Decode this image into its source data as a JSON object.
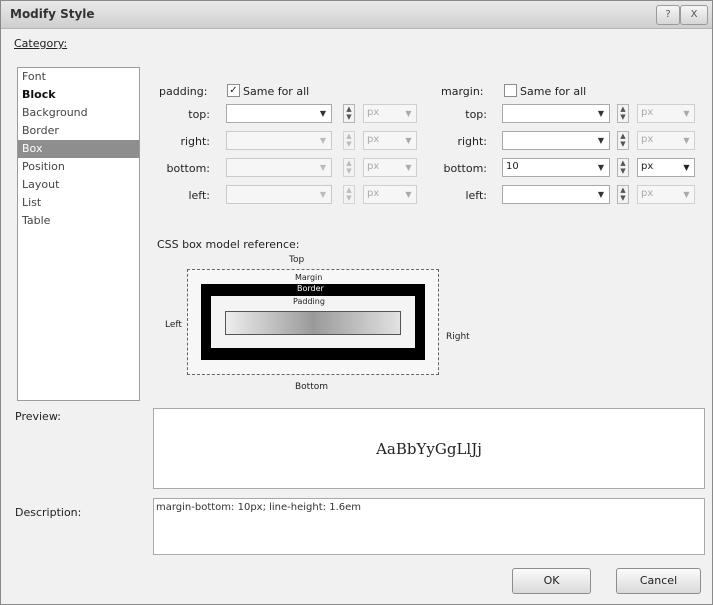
{
  "window": {
    "title": "Modify Style",
    "controls": [
      "?",
      "X"
    ]
  },
  "category": {
    "label": "Category:",
    "items": [
      {
        "label": "Font",
        "state": "normal"
      },
      {
        "label": "Block",
        "state": "bold"
      },
      {
        "label": "Background",
        "state": "normal"
      },
      {
        "label": "Border",
        "state": "normal"
      },
      {
        "label": "Box",
        "state": "selected"
      },
      {
        "label": "Position",
        "state": "normal"
      },
      {
        "label": "Layout",
        "state": "normal"
      },
      {
        "label": "List",
        "state": "normal"
      },
      {
        "label": "Table",
        "state": "normal"
      }
    ]
  },
  "padding": {
    "label": "padding:",
    "same_for_all_label": "Same for all",
    "same_for_all_checked": true,
    "sides": [
      {
        "label": "top:",
        "value": "",
        "unit": "px",
        "enabled": true
      },
      {
        "label": "right:",
        "value": "",
        "unit": "px",
        "enabled": false
      },
      {
        "label": "bottom:",
        "value": "",
        "unit": "px",
        "enabled": false
      },
      {
        "label": "left:",
        "value": "",
        "unit": "px",
        "enabled": false
      }
    ]
  },
  "margin": {
    "label": "margin:",
    "same_for_all_label": "Same for all",
    "same_for_all_checked": false,
    "sides": [
      {
        "label": "top:",
        "value": "",
        "unit": "px",
        "enabled": false
      },
      {
        "label": "right:",
        "value": "",
        "unit": "px",
        "enabled": false
      },
      {
        "label": "bottom:",
        "value": "10",
        "unit": "px",
        "enabled": true
      },
      {
        "label": "left:",
        "value": "",
        "unit": "px",
        "enabled": false
      }
    ]
  },
  "box_model": {
    "heading": "CSS box model reference:",
    "top": "Top",
    "bottom": "Bottom",
    "left": "Left",
    "right": "Right",
    "margin": "Margin",
    "border": "Border",
    "padding": "Padding"
  },
  "preview": {
    "label": "Preview:",
    "sample": "AaBbYyGgLlJj"
  },
  "description": {
    "label": "Description:",
    "text": "margin-bottom: 10px; line-height: 1.6em"
  },
  "buttons": {
    "ok": "OK",
    "cancel": "Cancel"
  }
}
